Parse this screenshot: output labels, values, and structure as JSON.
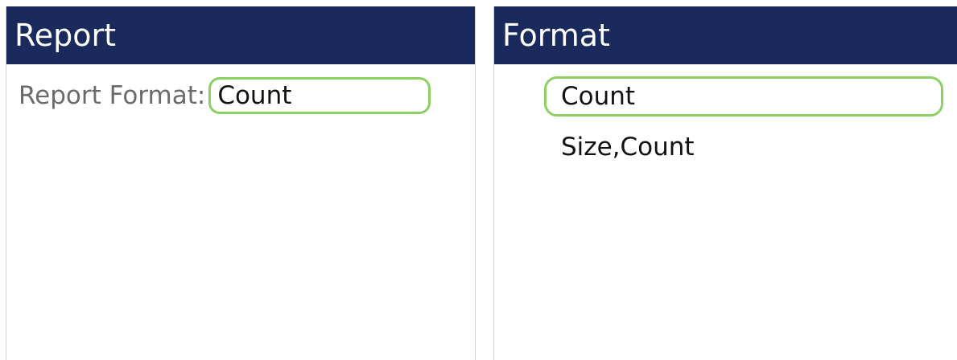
{
  "report_panel": {
    "title": "Report",
    "field_label": "Report Format:",
    "field_value": "Count"
  },
  "format_panel": {
    "title": "Format",
    "options": [
      {
        "label": "Count",
        "selected": true
      },
      {
        "label": "Size,Count",
        "selected": false
      }
    ]
  },
  "colors": {
    "header_background": "#1a2a5c",
    "header_text": "#ffffff",
    "highlight_border": "#8ccf63",
    "label_text": "#6a6a6a"
  }
}
